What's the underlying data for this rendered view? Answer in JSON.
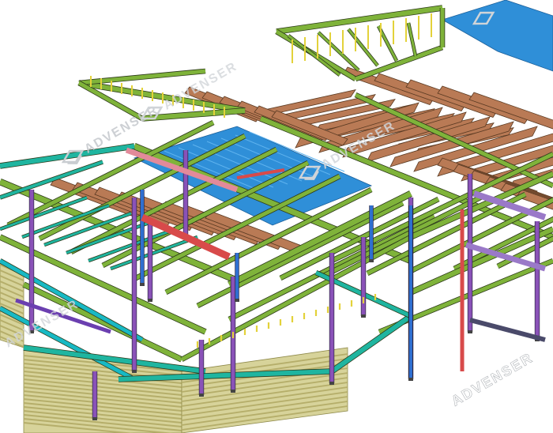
{
  "watermark": {
    "text": "ADVENSER",
    "color": "#9aa0a6"
  },
  "palette": {
    "beam_green": "#7fb33a",
    "beam_green_dark": "#4e7f1f",
    "beam_teal": "#1fb5a0",
    "beam_cyan": "#18b9c4",
    "beam_yellow": "#e3d23a",
    "column_purple": "#8a52b8",
    "column_blue": "#2f6fd0",
    "brace_red": "#d84a4a",
    "deck_brown": "#b97a55",
    "deck_brown_dark": "#8b5637",
    "roof_blue": "#2f8fd8",
    "cladding_lines": "#b5ae6a",
    "cladding_fill": "#d7d39a"
  }
}
